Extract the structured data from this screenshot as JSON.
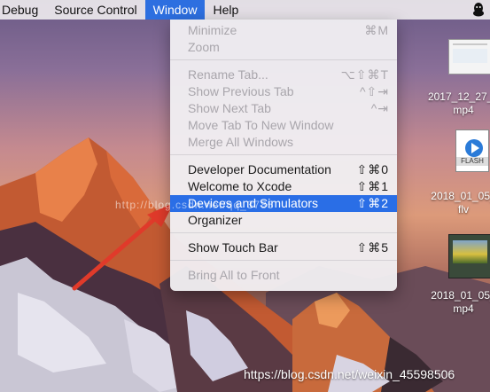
{
  "menubar": {
    "items": [
      "Debug",
      "Source Control",
      "Window",
      "Help"
    ]
  },
  "menu": {
    "minimize": {
      "label": "Minimize",
      "shortcut": "⌘M"
    },
    "zoom": {
      "label": "Zoom"
    },
    "rename_tab": {
      "label": "Rename Tab...",
      "shortcut": "⌥⇧⌘T"
    },
    "show_prev_tab": {
      "label": "Show Previous Tab",
      "shortcut": "^⇧⇥"
    },
    "show_next_tab": {
      "label": "Show Next Tab",
      "shortcut": "^⇥"
    },
    "move_tab": {
      "label": "Move Tab To New Window"
    },
    "merge_windows": {
      "label": "Merge All Windows"
    },
    "dev_docs": {
      "label": "Developer Documentation",
      "shortcut": "⇧⌘0"
    },
    "welcome": {
      "label": "Welcome to Xcode",
      "shortcut": "⇧⌘1"
    },
    "devices": {
      "label": "Devices and Simulators",
      "shortcut": "⇧⌘2"
    },
    "organizer": {
      "label": "Organizer"
    },
    "touch_bar": {
      "label": "Show Touch Bar",
      "shortcut": "⇧⌘5"
    },
    "bring_front": {
      "label": "Bring All to Front"
    }
  },
  "desktop_files": [
    {
      "name_line1": "2017_12_27_0",
      "name_line2": "mp4"
    },
    {
      "name_line1": "2018_01_05_",
      "name_line2": "flv"
    },
    {
      "name_line1": "2018_01_05_",
      "name_line2": "mp4"
    }
  ],
  "flash_badge": "FLASH",
  "watermark": {
    "bottom": "https://blog.csdn.net/weixin_45598506",
    "mid": "http://blog.csdn.net/qq_3785"
  },
  "colors": {
    "menu_highlight": "#2a6ee6",
    "arrow": "#e03a2a"
  }
}
